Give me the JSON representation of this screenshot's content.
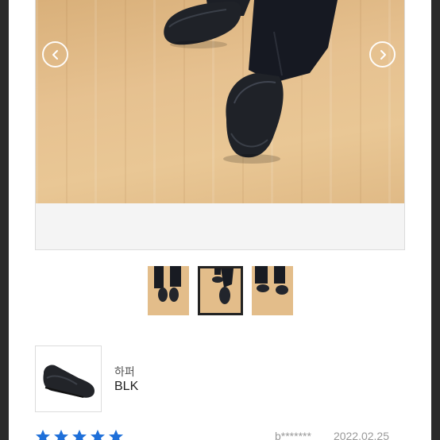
{
  "viewer": {
    "prev_icon": "chevron-left-icon",
    "next_icon": "chevron-right-icon"
  },
  "thumbnails": [
    {
      "selected": false
    },
    {
      "selected": true
    },
    {
      "selected": false
    }
  ],
  "product": {
    "name": "하퍼",
    "option": "BLK"
  },
  "review": {
    "rating": 5,
    "star_color": "#1e6fd9",
    "author": "b*******",
    "date": "2022.02.25"
  },
  "colors": {
    "accent": "#1e6fd9"
  }
}
